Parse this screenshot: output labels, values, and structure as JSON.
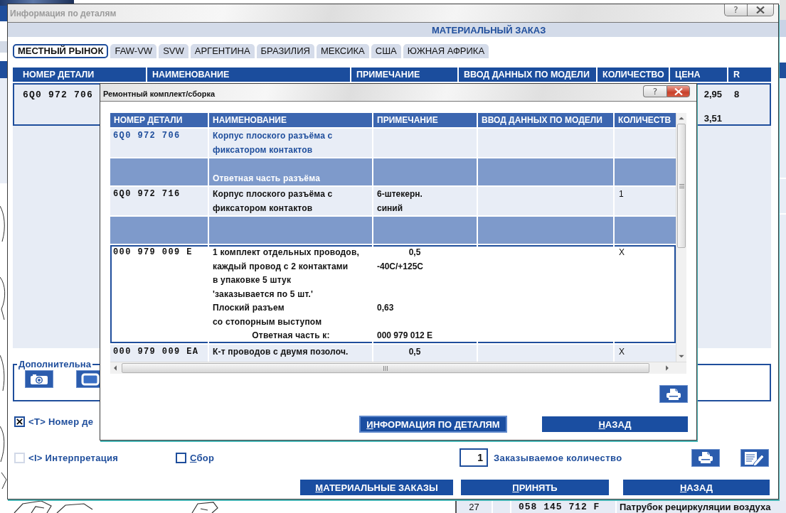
{
  "background_app": {
    "list_row": [
      "27",
      "058 145 712 F",
      "Патрубок рециркуляции воздуха"
    ]
  },
  "main_window": {
    "title": "Информация по деталям",
    "active": false,
    "help_label": "?",
    "header": "МАТЕРИАЛЬНЫЙ ЗАКАЗ",
    "tabs": [
      {
        "label": "МЕСТНЫЙ РЫНОК",
        "selected": true
      },
      {
        "label": "FAW-VW",
        "selected": false
      },
      {
        "label": "SVW",
        "selected": false
      },
      {
        "label": "АРГЕНТИНА",
        "selected": false
      },
      {
        "label": "БРАЗИЛИЯ",
        "selected": false
      },
      {
        "label": "МЕКСИКА",
        "selected": false
      },
      {
        "label": "США",
        "selected": false
      },
      {
        "label": "ЮЖНАЯ АФРИКА",
        "selected": false
      }
    ],
    "table": {
      "columns": [
        "НОМЕР ДЕТАЛИ",
        "НАИМЕНОВАНИЕ",
        "ПРИМЕЧАНИЕ",
        "ВВОД ДАННЫХ ПО МОДЕЛИ",
        "КОЛИЧЕСТВО",
        "ЦЕНА",
        "R"
      ],
      "rows": [
        {
          "part_no": "6Q0 972 706",
          "price": [
            "2,95",
            "3,51"
          ],
          "r": "8",
          "selected": true
        }
      ]
    },
    "extra_group": {
      "title": "Дополнительна"
    },
    "checkboxes": [
      {
        "label": "<T> Номер де",
        "checked": true,
        "disabled": false,
        "mnemonic": false
      },
      {
        "label": "<I> Интерпретация",
        "checked": false,
        "disabled": true,
        "mnemonic": false
      },
      {
        "label": "Сбор",
        "checked": false,
        "disabled": false,
        "mnemonic": true
      }
    ],
    "quantity": {
      "value": "1",
      "label": "Заказываемое количество"
    },
    "buttons": [
      {
        "label": "МАТЕРИАЛЬНЫЕ ЗАКАЗЫ",
        "mnemonic": true
      },
      {
        "label": "ПРИНЯТЬ",
        "mnemonic": true
      },
      {
        "label": "НАЗАД",
        "mnemonic": true
      }
    ]
  },
  "dialog": {
    "title": "Ремонтный комплект/сборка",
    "active": true,
    "help_label": "?",
    "table": {
      "columns": [
        "НОМЕР ДЕТАЛИ",
        "НАИМЕНОВАНИЕ",
        "ПРИМЕЧАНИЕ",
        "ВВОД ДАННЫХ ПО МОДЕЛИ",
        "КОЛИЧЕСТВ"
      ],
      "rows": [
        {
          "kind": "assembly",
          "selected": false,
          "part_no": "6Q0 972 706",
          "lines": [
            {
              "name": "Корпус плоского разъёма с"
            },
            {
              "name": "фиксатором контактов"
            }
          ]
        },
        {
          "kind": "group",
          "selected": false,
          "lines": [
            {
              "name": "Ответная часть разъёма"
            }
          ]
        },
        {
          "kind": "part",
          "selected": false,
          "part_no": "6Q0 972 716",
          "lines": [
            {
              "name": "Корпус плоского разъёма с",
              "note": "6-штекерн."
            },
            {
              "name": "фиксатором контактов",
              "note": "синий"
            }
          ],
          "quantity": "1"
        },
        {
          "kind": "group",
          "selected": false
        },
        {
          "kind": "part",
          "selected": true,
          "part_no": "000 979 009 E",
          "lines": [
            {
              "name": "1 комплект отдельных проводов,",
              "note": "0,5",
              "note_centered": true
            },
            {
              "name": "каждый провод с 2 контактами",
              "note": "-40C/+125C"
            },
            {
              "name": "в упаковке 5 штук"
            },
            {
              "name": "'заказывается по 5 шт.'"
            },
            {
              "name": "Плоский разъем",
              "note": "0,63"
            },
            {
              "name": "со стопорным выступом"
            },
            {
              "kind": "counterpart",
              "name": "Ответная часть к:",
              "note": "000 979 012 E"
            }
          ],
          "quantity": "X"
        },
        {
          "kind": "part",
          "selected": false,
          "part_no": "000 979 009 EA",
          "lines": [
            {
              "name": "К-т проводов с двумя позолоч.",
              "note": "0,5",
              "note_centered": true
            }
          ],
          "quantity": "X"
        }
      ]
    },
    "buttons": [
      {
        "label": "ИНФОРМАЦИЯ ПО ДЕТАЛЯМ",
        "mnemonic": true,
        "focused": true
      },
      {
        "label": "НАЗАД",
        "mnemonic": true,
        "focused": false
      }
    ]
  }
}
